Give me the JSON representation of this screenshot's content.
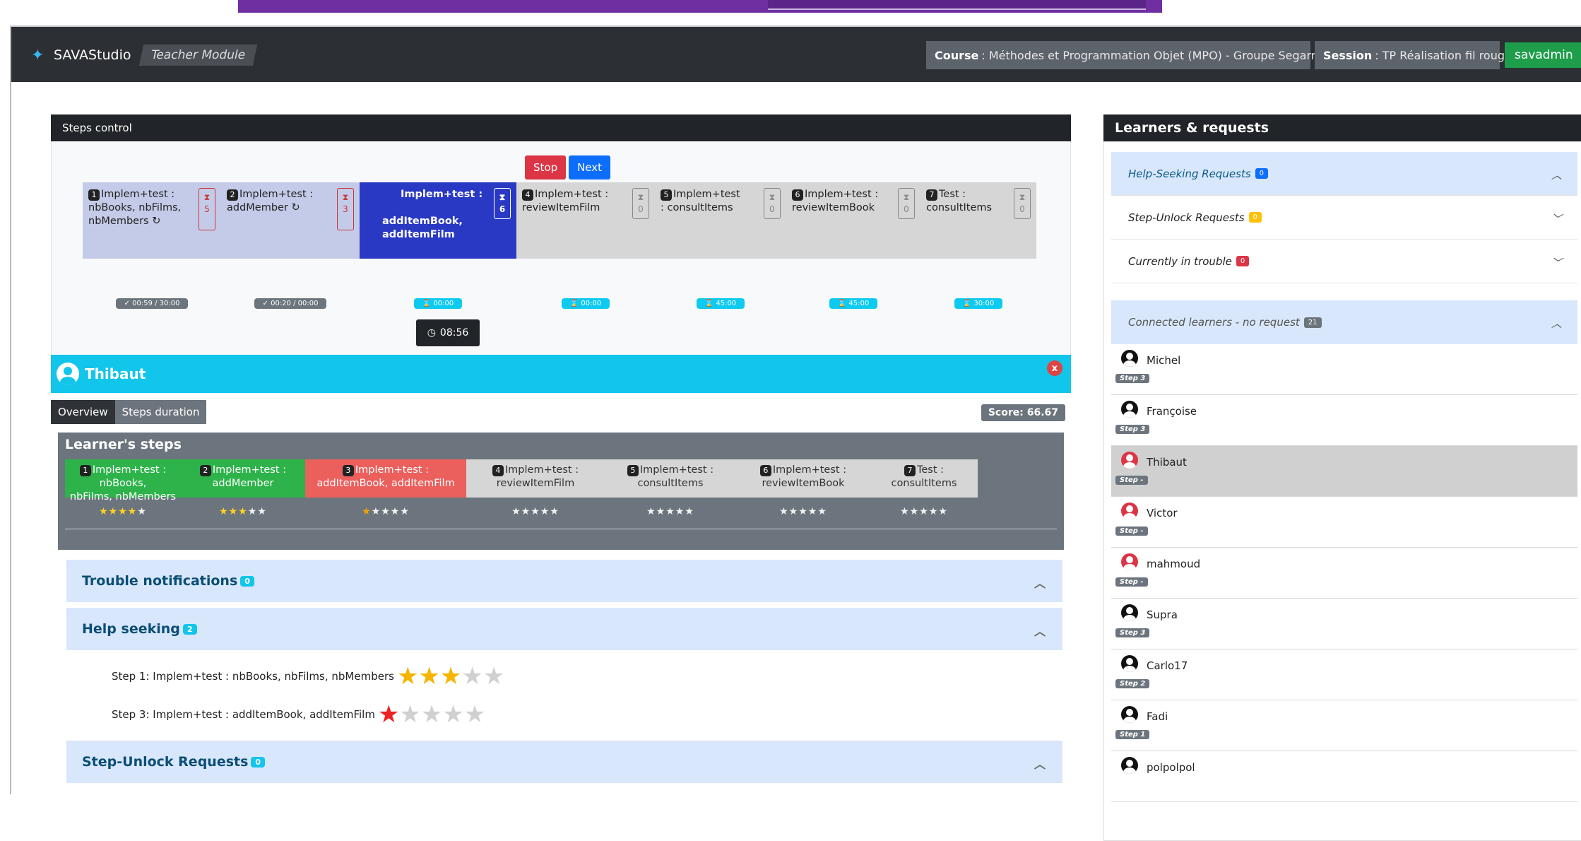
{
  "navbar": {
    "brand": "SAVAStudio",
    "module": "Teacher Module",
    "course_label": "Course",
    "course_value": ": Méthodes et Programmation Objet (MPO) - Groupe Segarra",
    "session_label": "Session",
    "session_value": ": TP Réalisation fil rouge",
    "user": "savadmin",
    "brand_color": "#38b6f0"
  },
  "steps_control": {
    "title": "Steps control",
    "stop": "Stop",
    "next": "Next",
    "steps": [
      {
        "num": "1",
        "l1": "Implem+test :",
        "l2": "nbBooks, nbFilms,",
        "l3": "nbMembers ↻",
        "count": "5",
        "timer": "✓ 00:59 / 30:00"
      },
      {
        "num": "2",
        "l1": "Implem+test :",
        "l2": "addMember ↻",
        "l3": "",
        "count": "3",
        "timer": "✓ 00:20 / 00:00"
      },
      {
        "num": "3",
        "l1": "Implem+test :",
        "l2": "addItemBook,",
        "l3": "addItemFilm",
        "count": "6",
        "timer": "⌛ 00:00"
      },
      {
        "num": "4",
        "l1": "Implem+test :",
        "l2": "reviewItemFilm",
        "l3": "",
        "count": "0",
        "timer": "⌛ 00:00"
      },
      {
        "num": "5",
        "l1": "Implem+test",
        "l2": ": consultItems",
        "l3": "",
        "count": "0",
        "timer": "⌛ 45:00"
      },
      {
        "num": "6",
        "l1": "Implem+test :",
        "l2": "reviewItemBook",
        "l3": "",
        "count": "0",
        "timer": "⌛ 45:00"
      },
      {
        "num": "7",
        "l1": "Test :",
        "l2": "consultItems",
        "l3": "",
        "count": "0",
        "timer": "⌛ 30:00"
      }
    ],
    "tooltip": "08:56"
  },
  "learner": {
    "name": "Thibaut",
    "close": "x",
    "tab_overview": "Overview",
    "tab_duration": "Steps duration",
    "score": "Score: 66.67",
    "steps_title": "Learner's steps",
    "steps": [
      {
        "num": "1",
        "l1": "Implem+test : nbBooks,",
        "l2": "nbFilms, nbMembers",
        "stars": 4
      },
      {
        "num": "2",
        "l1": "Implem+test :",
        "l2": "addMember",
        "stars": 3
      },
      {
        "num": "3",
        "l1": "Implem+test :",
        "l2": "addItemBook, addItemFilm",
        "stars": 1
      },
      {
        "num": "4",
        "l1": "Implem+test :",
        "l2": "reviewItemFilm",
        "stars": 0
      },
      {
        "num": "5",
        "l1": "Implem+test :",
        "l2": "consultItems",
        "stars": 0
      },
      {
        "num": "6",
        "l1": "Implem+test :",
        "l2": "reviewItemBook",
        "stars": 0
      },
      {
        "num": "7",
        "l1": "Test :",
        "l2": "consultItems",
        "stars": 0
      }
    ],
    "trouble_label": "Trouble notifications",
    "trouble_count": "0",
    "help_label": "Help seeking",
    "help_count": "2",
    "help_items": [
      {
        "text": "Step 1: Implem+test : nbBooks, nbFilms, nbMembers",
        "stars": 3
      },
      {
        "text": "Step 3: Implem+test : addItemBook, addItemFilm",
        "stars": 1
      }
    ],
    "unlock_label": "Step-Unlock Requests",
    "unlock_count": "0"
  },
  "right": {
    "title": "Learners & requests",
    "help_requests": "Help-Seeking Requests",
    "help_requests_count": "0",
    "unlock_requests": "Step-Unlock Requests",
    "unlock_requests_count": "0",
    "trouble": "Currently in trouble",
    "trouble_count": "0",
    "connected": "Connected learners - no request",
    "connected_count": "21",
    "learners": [
      {
        "name": "Michel",
        "step": "Step 3",
        "color": "#111"
      },
      {
        "name": "Françoise",
        "step": "Step 3",
        "color": "#111"
      },
      {
        "name": "Thibaut",
        "step": "Step -",
        "color": "#dc3545"
      },
      {
        "name": "Victor",
        "step": "Step -",
        "color": "#dc3545"
      },
      {
        "name": "mahmoud",
        "step": "Step -",
        "color": "#dc3545"
      },
      {
        "name": "Supra",
        "step": "Step 3",
        "color": "#111"
      },
      {
        "name": "Carlo17",
        "step": "Step 2",
        "color": "#111"
      },
      {
        "name": "Fadi",
        "step": "Step 1",
        "color": "#111"
      },
      {
        "name": "polpolpol",
        "step": "",
        "color": "#111"
      }
    ]
  }
}
